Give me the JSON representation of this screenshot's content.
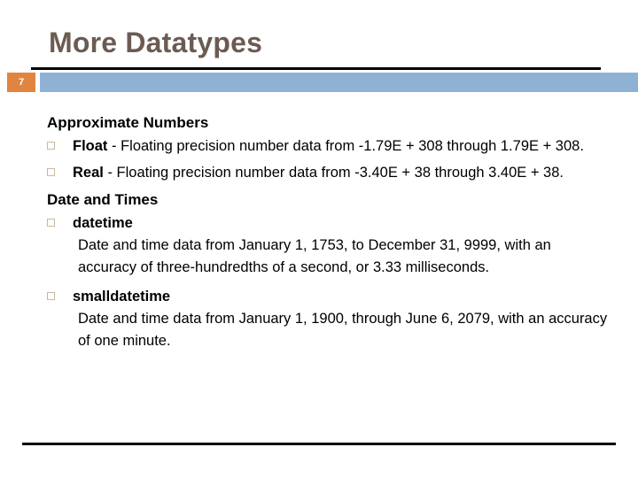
{
  "slide": {
    "title": "More Datatypes",
    "number": "7",
    "accent_orange": "#E0853F",
    "accent_blue": "#8FB2D4",
    "title_color": "#6B5B52",
    "bullet_color": "#CBB89E",
    "rule_color": "#000000"
  },
  "content": {
    "section1": {
      "heading": "Approximate Numbers",
      "bullets": [
        {
          "lead": "Float",
          "rest": " - Floating precision number data from -1.79E + 308 through 1.79E + 308."
        },
        {
          "lead": "Real",
          "rest": " - Floating precision number data from -3.40E + 38 through 3.40E + 38."
        }
      ]
    },
    "section2": {
      "heading": "Date and Times",
      "bullets": [
        {
          "label": "datetime",
          "description": "Date and time data from January 1, 1753, to December 31, 9999, with an accuracy of three-hundredths of a second, or 3.33 milliseconds."
        },
        {
          "label": "smalldatetime",
          "description": "Date and time data from January 1, 1900, through June 6, 2079, with an accuracy of one minute."
        }
      ]
    }
  }
}
